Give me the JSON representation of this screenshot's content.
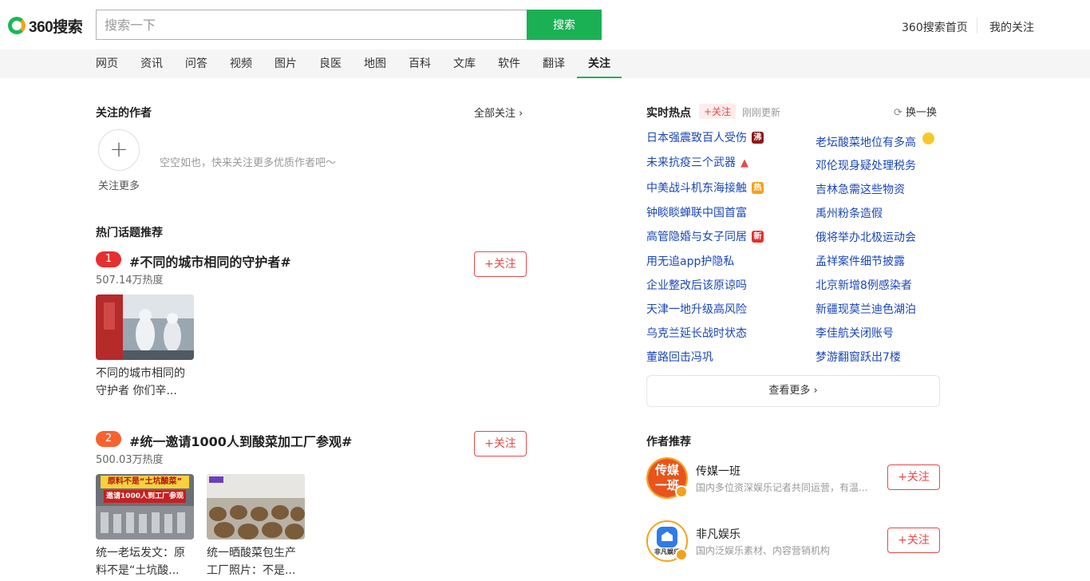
{
  "header": {
    "logo_text": "360搜索",
    "search_placeholder": "搜索一下",
    "search_button": "搜索",
    "links": [
      "360搜索首页",
      "我的关注"
    ]
  },
  "nav": {
    "tabs": [
      "网页",
      "资讯",
      "问答",
      "视频",
      "图片",
      "良医",
      "地图",
      "百科",
      "文库",
      "软件",
      "翻译",
      "关注"
    ],
    "active": "关注"
  },
  "followed_authors": {
    "title": "关注的作者",
    "all_link": "全部关注",
    "add_label": "关注更多",
    "empty_tip": "空空如也，快来关注更多优质作者吧～"
  },
  "hot_topics": {
    "title": "热门话题推荐",
    "topics": [
      {
        "rank": "1",
        "title": "#不同的城市相同的守护者#",
        "heat": "507.14万热度",
        "follow": "+关注",
        "rank_color": "#e62f2f",
        "cards": [
          {
            "caption_l1": "不同的城市相同的",
            "caption_l2": "守护者 你们辛..."
          }
        ]
      },
      {
        "rank": "2",
        "title": "#统一邀请1000人到酸菜加工厂参观#",
        "heat": "500.03万热度",
        "follow": "+关注",
        "rank_color": "#f7622f",
        "cards": [
          {
            "caption_l1": "统一老坛发文：原",
            "caption_l2": "料不是“土坑酸...",
            "thumb_text_1": "原料不是“土坑酸菜”",
            "thumb_text_2": "邀请1000人到工厂参观"
          },
          {
            "caption_l1": "统一晒酸菜包生产",
            "caption_l2": "工厂照片：不是..."
          }
        ]
      }
    ]
  },
  "realtime_hot": {
    "title": "实时热点",
    "tag": "+关注",
    "updated": "刚刚更新",
    "refresh": "换一换",
    "left": [
      {
        "text": "日本强震致百人受伤",
        "badge": "沸",
        "badge_color": "#8b1a1a"
      },
      {
        "text": "未来抗疫三个武器",
        "badge": "up",
        "badge_color": "#e64a4a"
      },
      {
        "text": "中美战斗机东海接触",
        "badge": "热",
        "badge_color": "#f4a21a"
      },
      {
        "text": "钟睒睒蝉联中国首富",
        "badge": "",
        "badge_color": ""
      },
      {
        "text": "高管隐婚与女子同居",
        "badge": "新",
        "badge_color": "#e62f2f"
      },
      {
        "text": "用无追app护隐私",
        "badge": "",
        "badge_color": ""
      },
      {
        "text": "企业整改后该原谅吗",
        "badge": "",
        "badge_color": ""
      },
      {
        "text": "天津一地升级高风险",
        "badge": "",
        "badge_color": ""
      },
      {
        "text": "乌克兰延长战时状态",
        "badge": "",
        "badge_color": ""
      },
      {
        "text": "董路回击冯巩",
        "badge": "",
        "badge_color": ""
      }
    ],
    "right": [
      {
        "text": "老坛酸菜地位有多高",
        "badge": "emoji"
      },
      {
        "text": "邓伦现身疑处理税务",
        "badge": ""
      },
      {
        "text": "吉林急需这些物资",
        "badge": ""
      },
      {
        "text": "禹州粉条造假",
        "badge": ""
      },
      {
        "text": "俄将举办北极运动会",
        "badge": ""
      },
      {
        "text": "孟祥案件细节披露",
        "badge": ""
      },
      {
        "text": "北京新增8例感染者",
        "badge": ""
      },
      {
        "text": "新疆现莫兰迪色湖泊",
        "badge": ""
      },
      {
        "text": "李佳航关闭账号",
        "badge": ""
      },
      {
        "text": "梦游翻窗跃出7楼",
        "badge": ""
      }
    ],
    "more": "查看更多"
  },
  "author_recommend": {
    "title": "作者推荐",
    "authors": [
      {
        "name": "传媒一班",
        "desc": "国内多位资深娱乐记者共同运营，有温...",
        "follow": "+关注",
        "logo_text": "传媒一班"
      },
      {
        "name": "非凡娱乐",
        "desc": "国内泛娱乐素材、内容营销机构",
        "follow": "+关注",
        "logo_text": "非凡娱乐"
      }
    ]
  }
}
